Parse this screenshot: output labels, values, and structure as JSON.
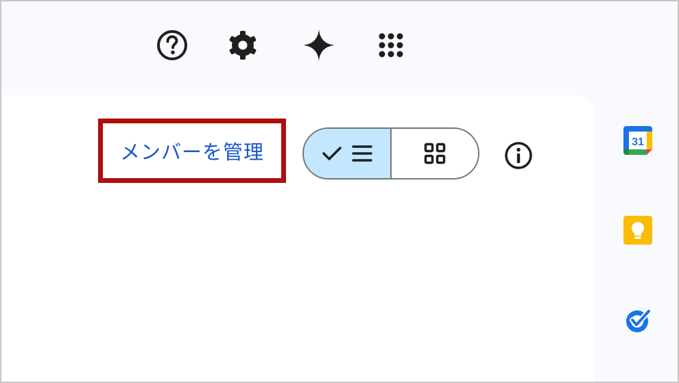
{
  "topbar": {
    "icons": {
      "help": "help-icon",
      "settings": "gear-icon",
      "gemini": "gemini-sparkle-icon",
      "apps": "apps-grid-icon"
    }
  },
  "main": {
    "manage_members_label": "メンバーを管理",
    "view_toggle": {
      "selected": "list",
      "list_icons": [
        "check-icon",
        "list-icon"
      ],
      "grid_icon": "grid-icon"
    },
    "info_icon": "info-icon"
  },
  "side_panel": {
    "apps": [
      {
        "name": "calendar",
        "icon": "calendar-icon",
        "date_number": "31"
      },
      {
        "name": "keep",
        "icon": "keep-icon"
      },
      {
        "name": "tasks",
        "icon": "tasks-icon"
      }
    ]
  },
  "colors": {
    "link_blue": "#1a56c9",
    "highlight_red": "#b00e0e",
    "toggle_selected_bg": "#c2e7ff",
    "keep_yellow": "#fbbc04",
    "tasks_blue": "#1a73e8"
  }
}
